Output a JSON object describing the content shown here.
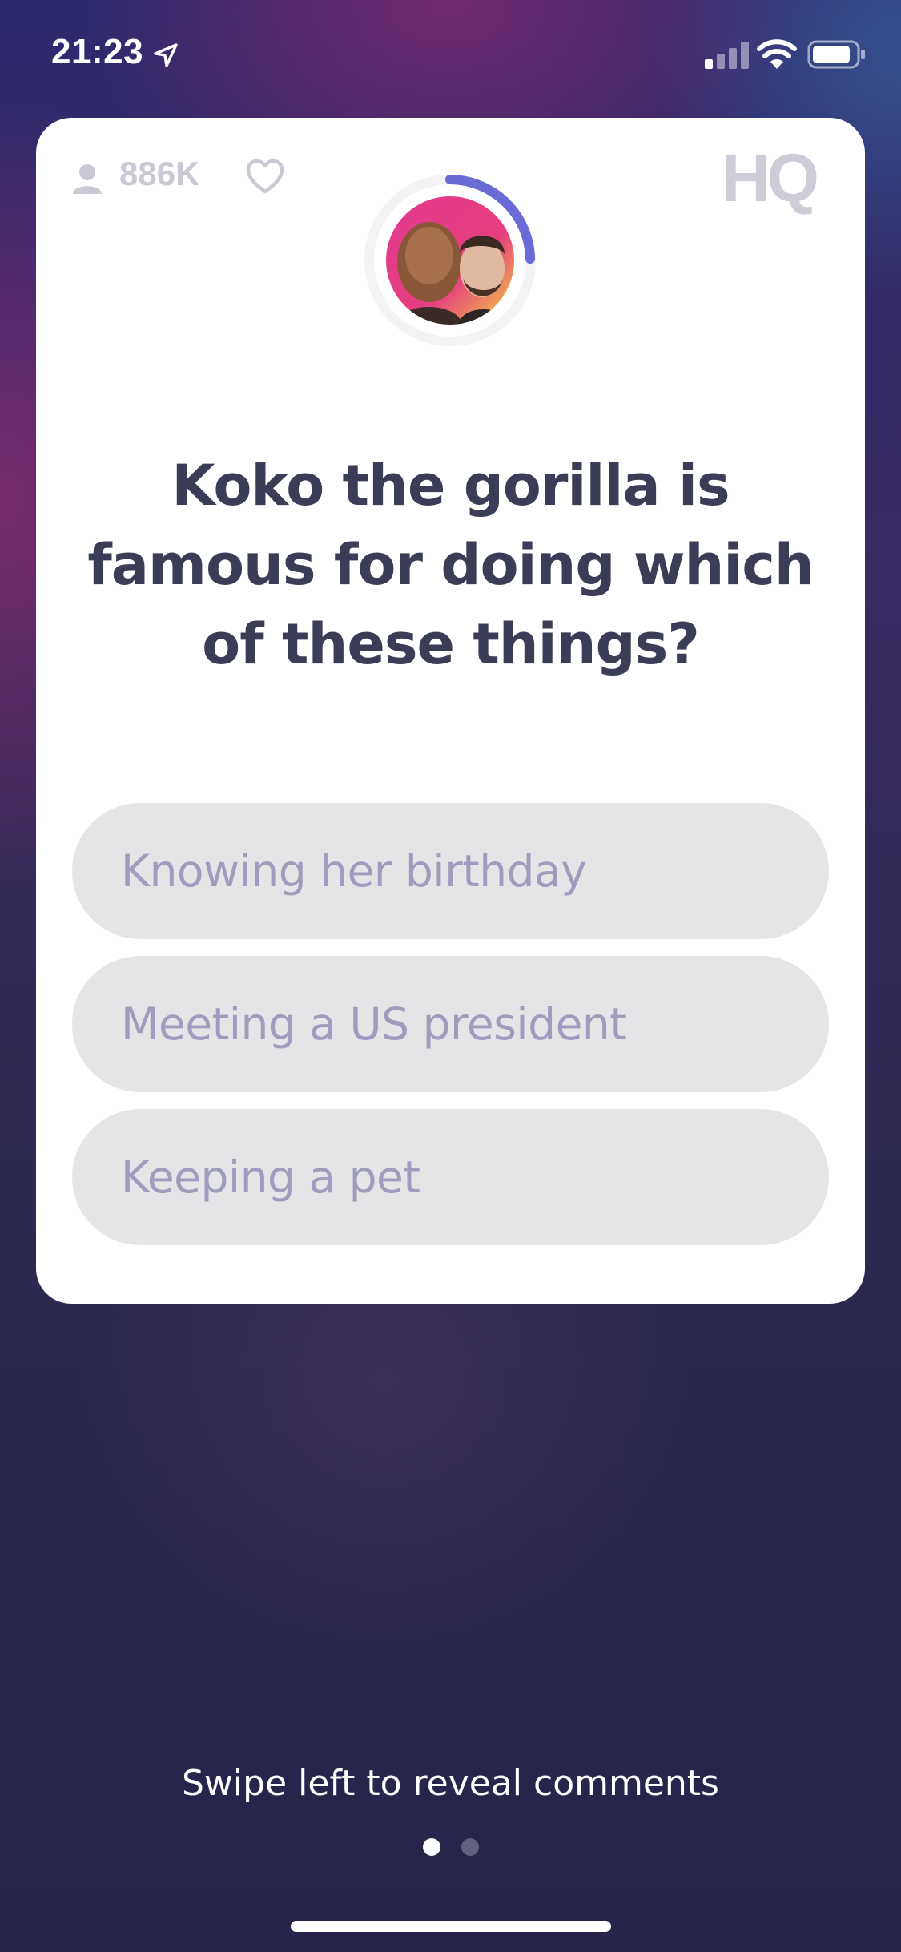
{
  "status_bar": {
    "time": "21:23",
    "icons": [
      "location-arrow-icon",
      "cellular-signal-icon",
      "wifi-icon",
      "battery-icon"
    ]
  },
  "card": {
    "viewer_count": "886K",
    "logo_text": "HQ",
    "icons": [
      "viewer-person-icon",
      "heart-icon"
    ],
    "question": "Koko the gorilla is famous for doing which of these things?",
    "answers": [
      {
        "label": "Knowing her birthday"
      },
      {
        "label": "Meeting a US president"
      },
      {
        "label": "Keeping a pet"
      }
    ],
    "colors": {
      "timer_ring": "#6a6bd6",
      "question_text": "#3b3c55",
      "answer_text": "#9f9dbd",
      "answer_background": "#e5e5e8"
    }
  },
  "footer": {
    "swipe_hint": "Swipe left to reveal comments",
    "pages": [
      {
        "active": true
      },
      {
        "active": false
      }
    ]
  }
}
